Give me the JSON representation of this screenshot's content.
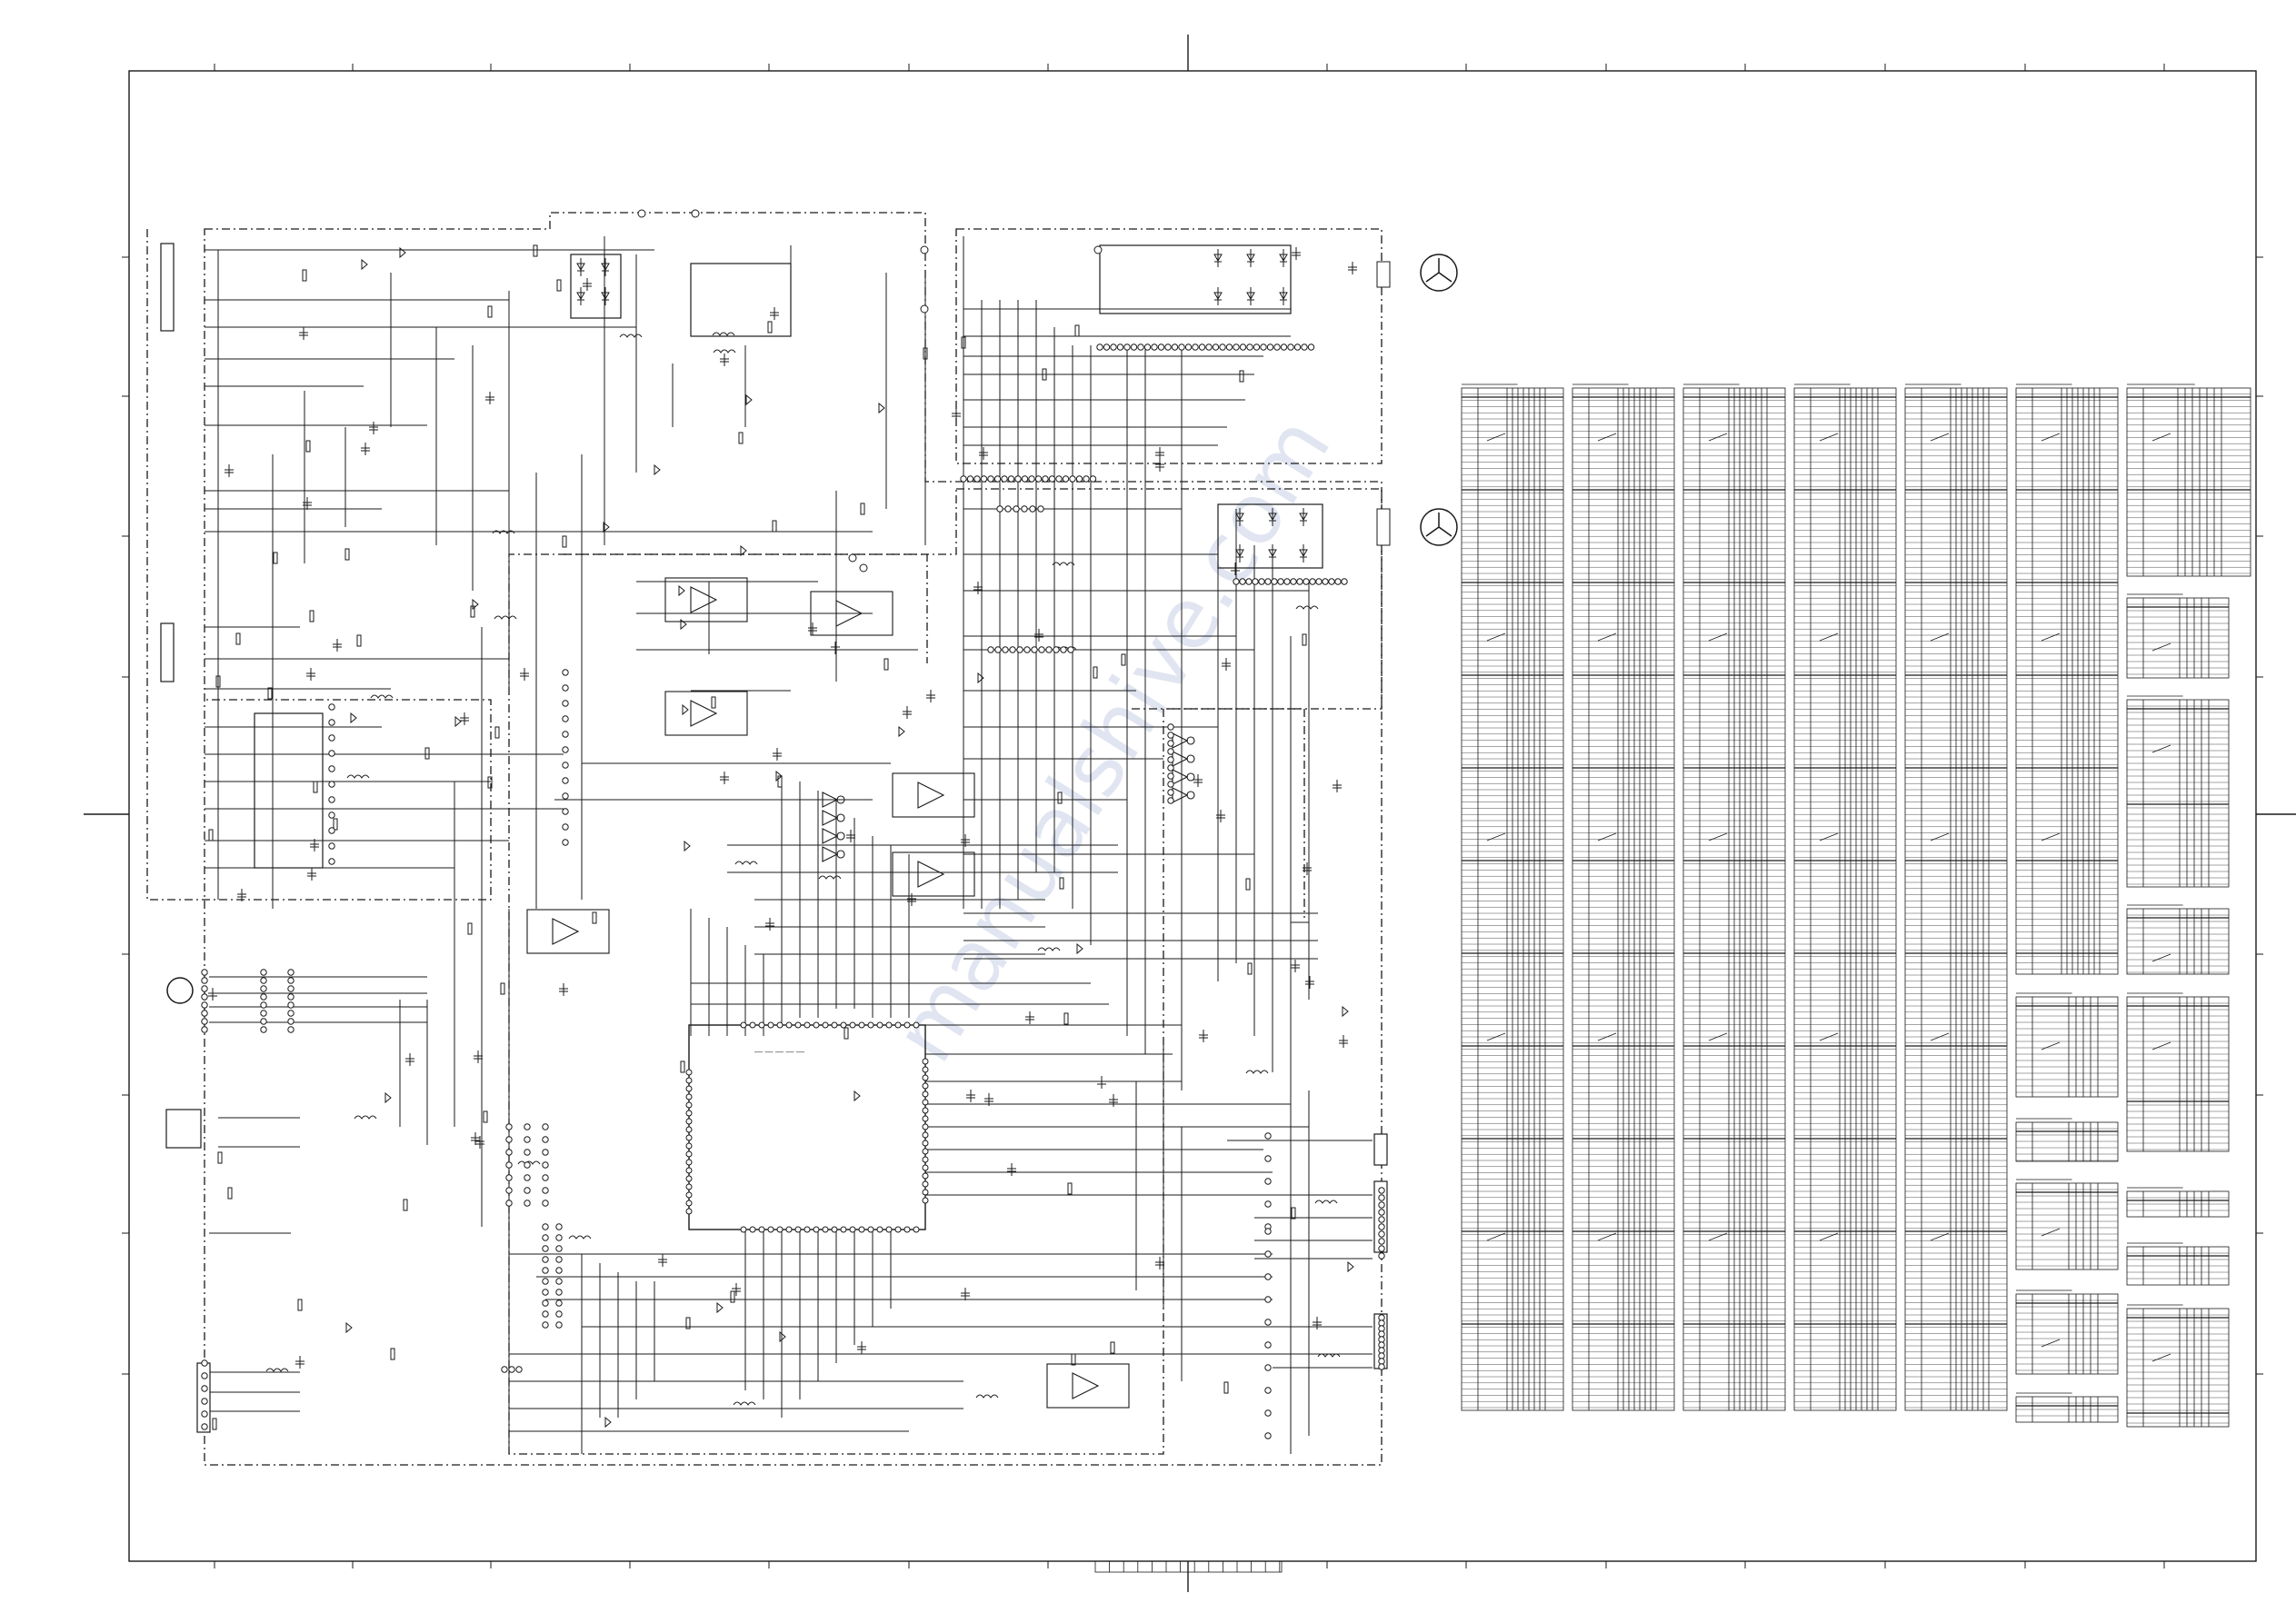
{
  "sheet": {
    "stroke": "#1a1a1a",
    "background": "#ffffff"
  },
  "watermark": {
    "text": "manualshive.com",
    "color": "#c7cfe6"
  },
  "schematic": {
    "motors": [
      {
        "symbol": "motor-icon",
        "label": ""
      },
      {
        "symbol": "motor-icon",
        "label": ""
      },
      {
        "symbol": "motor-icon",
        "label": ""
      }
    ],
    "connectors": [
      {
        "symbol": "connector-icon"
      },
      {
        "symbol": "connector-icon"
      },
      {
        "symbol": "connector-icon"
      },
      {
        "symbol": "connector-icon"
      },
      {
        "symbol": "connector-icon"
      },
      {
        "symbol": "connector-icon"
      }
    ],
    "ics": [
      {
        "symbol": "microcontroller-icon"
      },
      {
        "symbol": "power-module-icon"
      },
      {
        "symbol": "op-amp-icon"
      }
    ]
  },
  "parts_tables": [
    {
      "title": ""
    },
    {
      "title": ""
    },
    {
      "title": ""
    },
    {
      "title": ""
    },
    {
      "title": ""
    },
    {
      "title": ""
    },
    {
      "title": ""
    }
  ]
}
